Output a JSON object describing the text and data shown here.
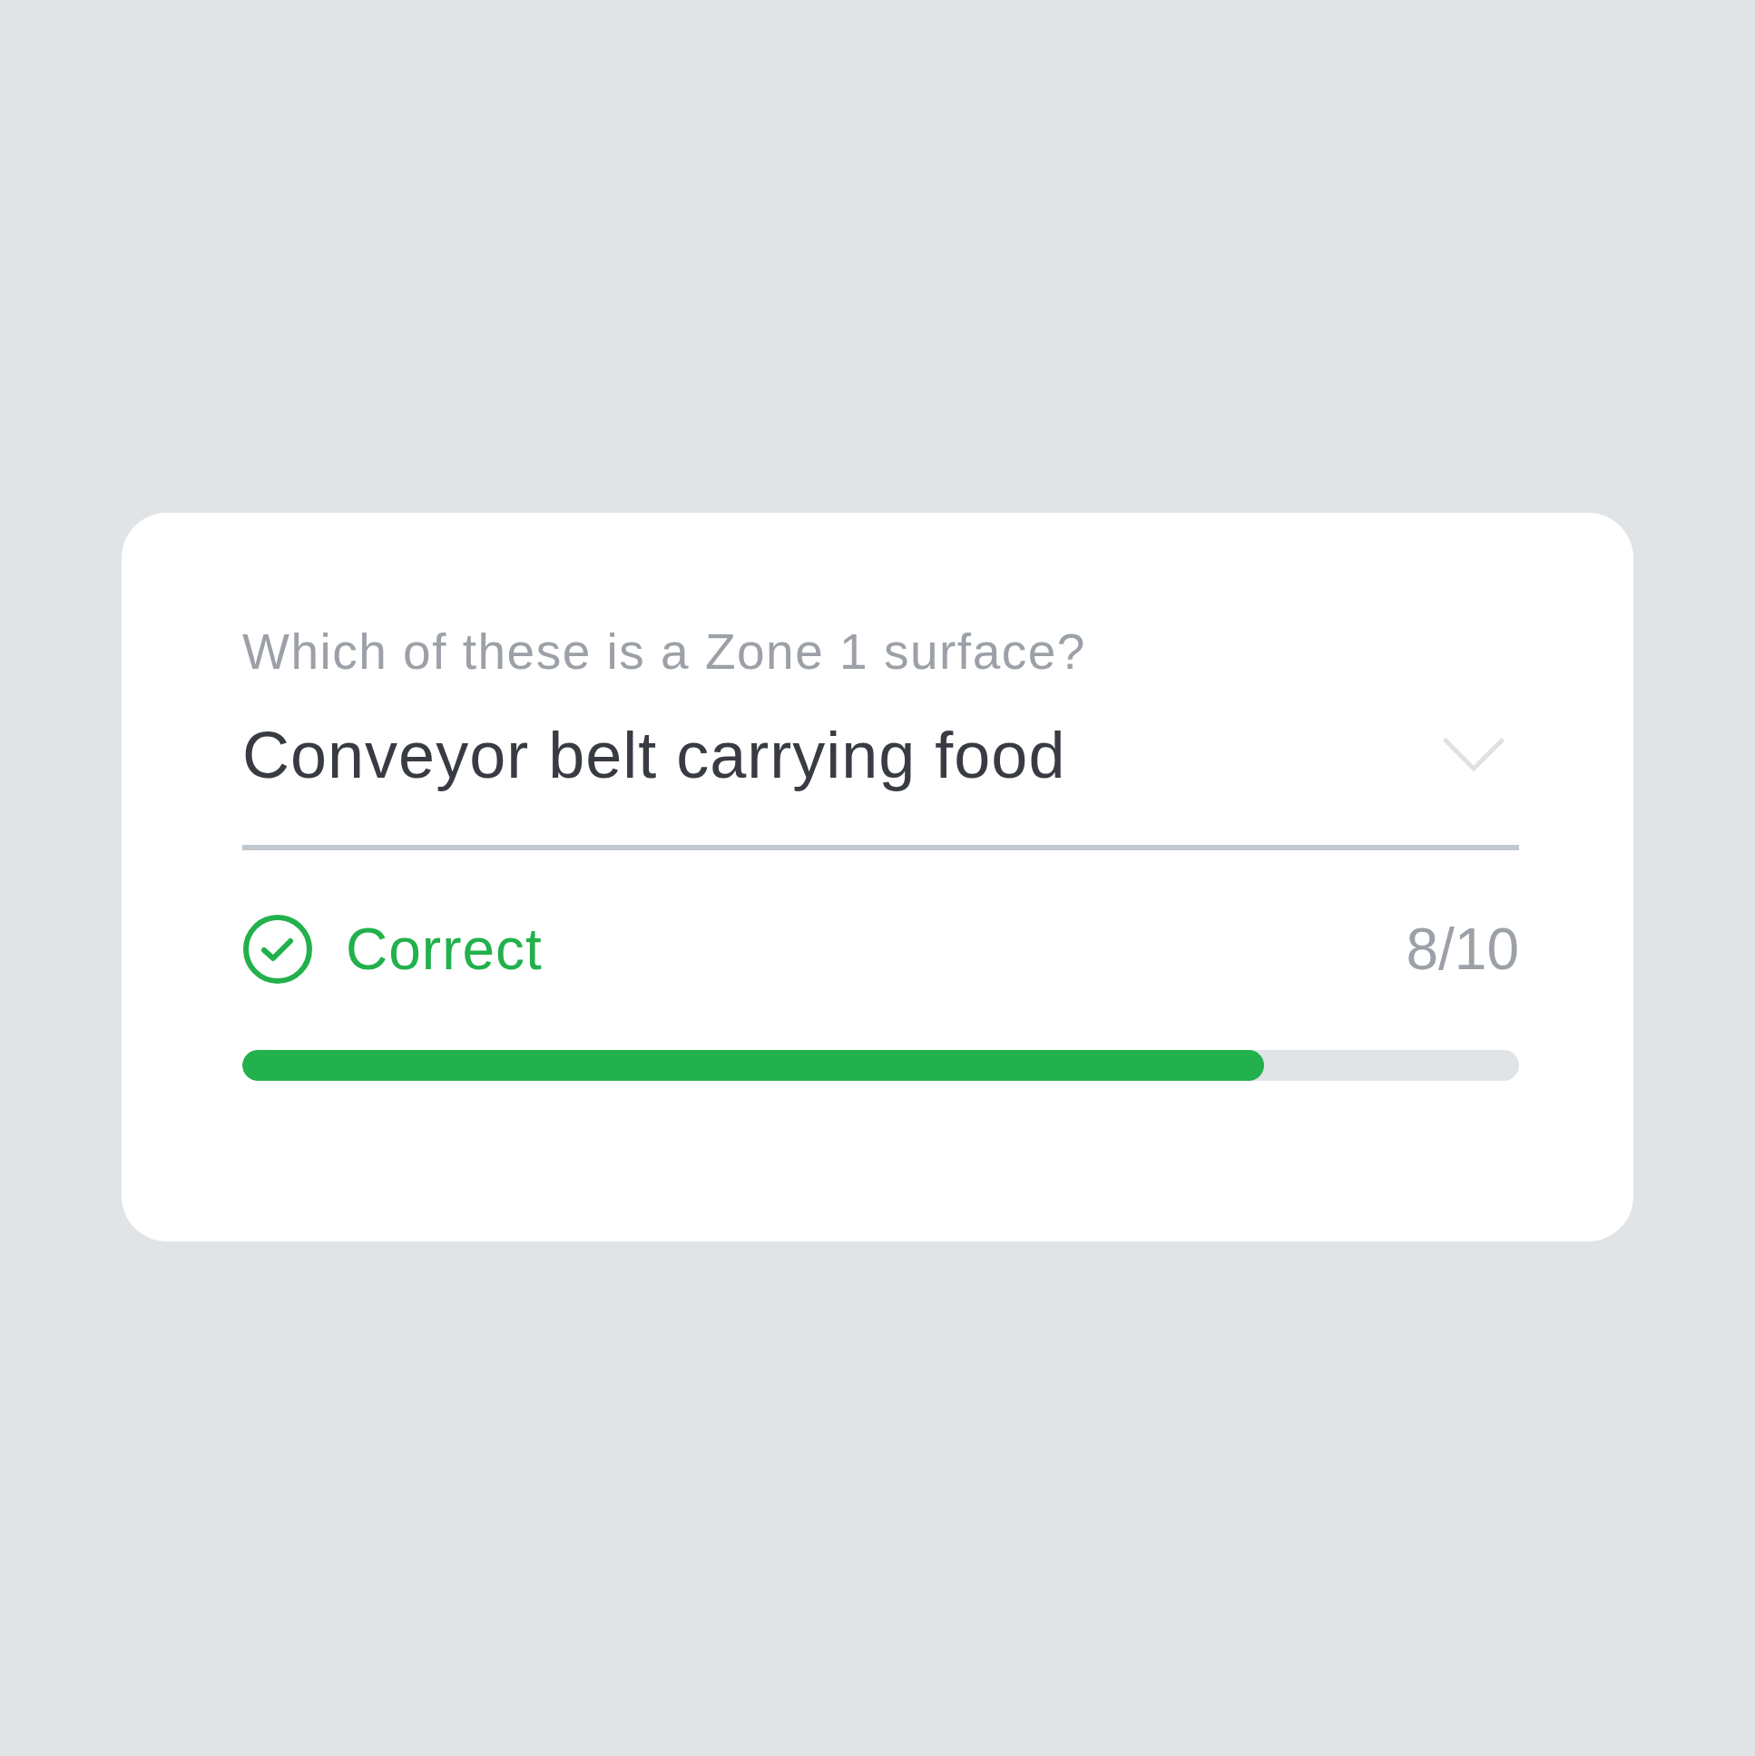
{
  "question": "Which of these is a Zone 1 surface?",
  "answer": {
    "value": "Conveyor belt carrying food"
  },
  "result": {
    "kind": "correct",
    "label": "Correct"
  },
  "score": "8/10",
  "progress": {
    "level": 0.8
  }
}
